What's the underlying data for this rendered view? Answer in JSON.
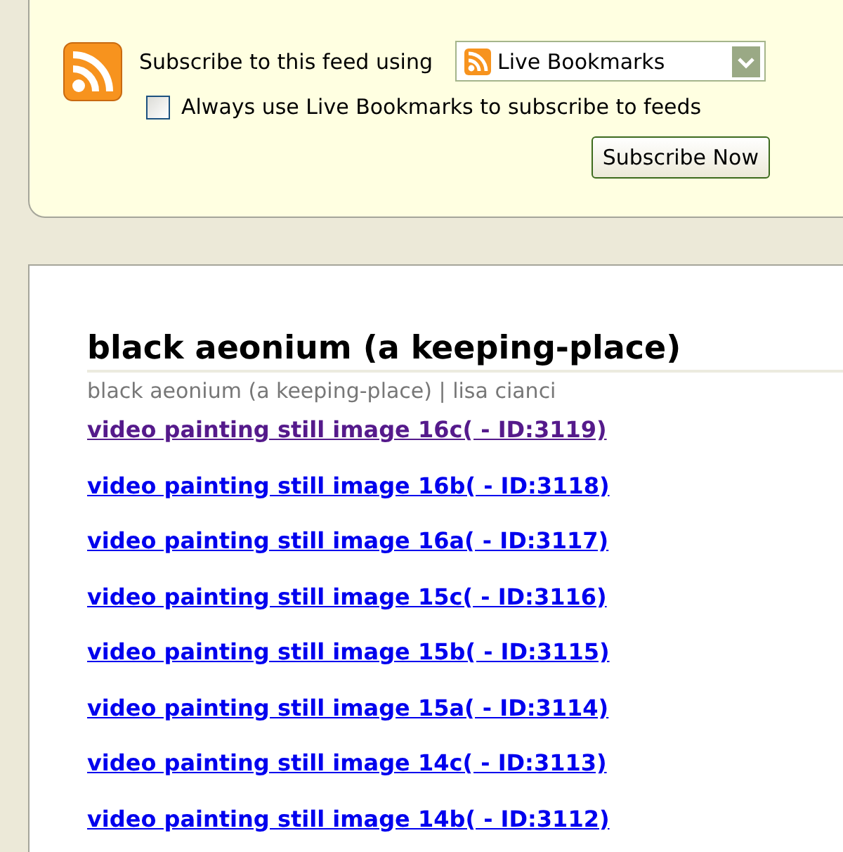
{
  "subscribe": {
    "label": "Subscribe to this feed using",
    "reader": "Live Bookmarks",
    "always_use": {
      "label": "Always use Live Bookmarks to subscribe to feeds",
      "checked": false
    },
    "button": "Subscribe Now"
  },
  "feed": {
    "title": "black aeonium (a keeping-place)",
    "subtitle": "black aeonium (a keeping-place) | lisa cianci",
    "items": [
      {
        "title": "video painting still image 16c( - ID:3119)",
        "visited": true
      },
      {
        "title": "video painting still image 16b( - ID:3118)",
        "visited": false
      },
      {
        "title": "video painting still image 16a( - ID:3117)",
        "visited": false
      },
      {
        "title": "video painting still image 15c( - ID:3116)",
        "visited": false
      },
      {
        "title": "video painting still image 15b( - ID:3115)",
        "visited": false
      },
      {
        "title": "video painting still image 15a( - ID:3114)",
        "visited": false
      },
      {
        "title": "video painting still image 14c( - ID:3113)",
        "visited": false
      },
      {
        "title": "video painting still image 14b( - ID:3112)",
        "visited": false
      }
    ]
  }
}
